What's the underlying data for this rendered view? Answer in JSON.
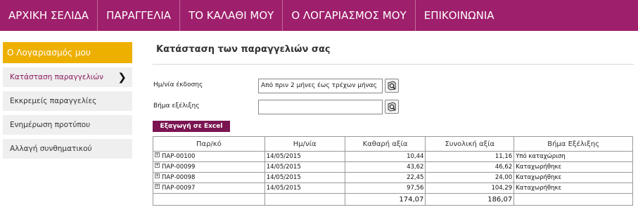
{
  "nav": {
    "items": [
      {
        "label": "ΑΡΧΙΚΗ ΣΕΛΙΔΑ"
      },
      {
        "label": "ΠΑΡΑΓΓΕΛΙΑ"
      },
      {
        "label": "ΤΟ ΚΑΛΑΘΙ ΜΟΥ"
      },
      {
        "label": "Ο ΛΟΓΑΡΙΑΣΜΟΣ ΜΟΥ"
      },
      {
        "label": "ΕΠΙΚΟΙΝΩΝΙΑ"
      }
    ]
  },
  "sidebar": {
    "header": "Ο Λογαριασμός μου",
    "items": [
      {
        "label": "Κατάσταση παραγγελιών",
        "chevron": "❯"
      },
      {
        "label": "Εκκρεμείς παραγγελίες κατ΄είδος"
      },
      {
        "label": "Ενημέρωση προτύπου"
      },
      {
        "label": "Αλλαγή συνθηματικού"
      }
    ]
  },
  "main": {
    "title": "Κατάσταση των παραγγελιών σας",
    "date_field": {
      "label": "Ημ/νία έκδοσης",
      "value": "Από πριν 2 μήνες έως τρέχων μήνας"
    },
    "step_field": {
      "label": "Βήμα εξέλιξης",
      "value": ""
    },
    "export_label": "Εξαγωγή σε Excel",
    "table": {
      "headers": [
        "Παρ/κό",
        "Ημ/νία",
        "Καθαρή αξία",
        "Συνολική αξία",
        "Βήμα Εξέλιξης"
      ],
      "expand_glyph": "+",
      "rows": [
        {
          "code": "ΠΑΡ-00100",
          "date": "14/05/2015",
          "net": "10,44",
          "total": "11,16",
          "step": "Υπό καταχώριση"
        },
        {
          "code": "ΠΑΡ-00099",
          "date": "14/05/2015",
          "net": "43,62",
          "total": "46,62",
          "step": "Καταχωρήθηκε"
        },
        {
          "code": "ΠΑΡ-00098",
          "date": "14/05/2015",
          "net": "22,45",
          "total": "24,00",
          "step": "Καταχωρήθηκε"
        },
        {
          "code": "ΠΑΡ-00097",
          "date": "14/05/2015",
          "net": "97,56",
          "total": "104,29",
          "step": "Καταχωρήθηκε"
        }
      ],
      "totals": {
        "net": "174,07",
        "total": "186,07"
      }
    }
  },
  "colors": {
    "nav_bg": "#9e1f6b",
    "sidebar_header_bg": "#eeb000",
    "export_bg": "#7b1551"
  },
  "icons": {
    "date_picker": "calendar-search-icon",
    "step_picker": "lookup-icon"
  }
}
